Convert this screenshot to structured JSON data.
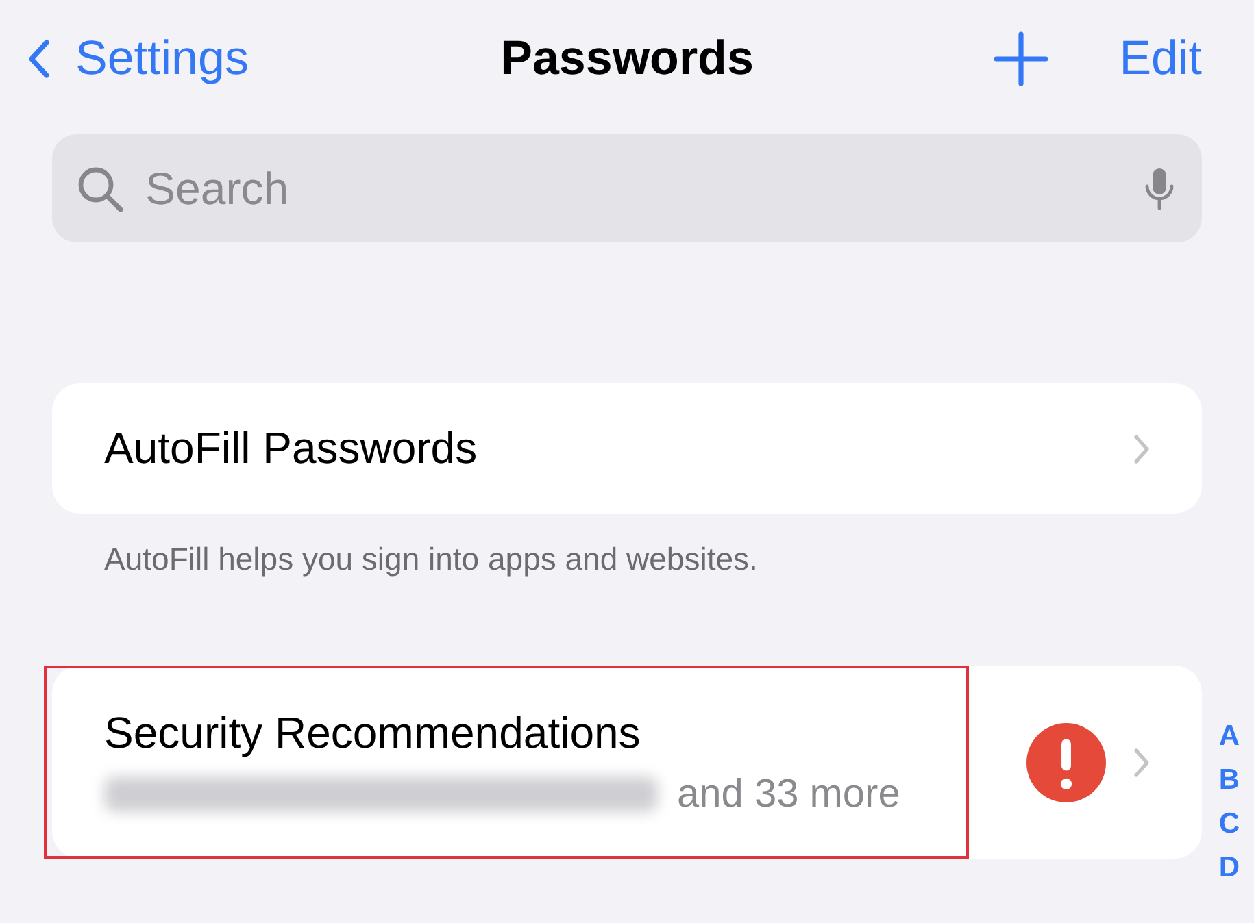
{
  "nav": {
    "back": "Settings",
    "title": "Passwords",
    "edit": "Edit"
  },
  "search": {
    "placeholder": "Search"
  },
  "sections": [
    {
      "rows": [
        {
          "title": "AutoFill Passwords",
          "highlighted": false
        }
      ],
      "footer": "AutoFill helps you sign into apps and websites."
    },
    {
      "rows": [
        {
          "title": "Security Recommendations",
          "subtitle": "and 33 more",
          "subtitle_redacted": true,
          "warning": true,
          "highlighted": true
        }
      ]
    }
  ],
  "index_letters": [
    "A",
    "B",
    "C",
    "D"
  ]
}
